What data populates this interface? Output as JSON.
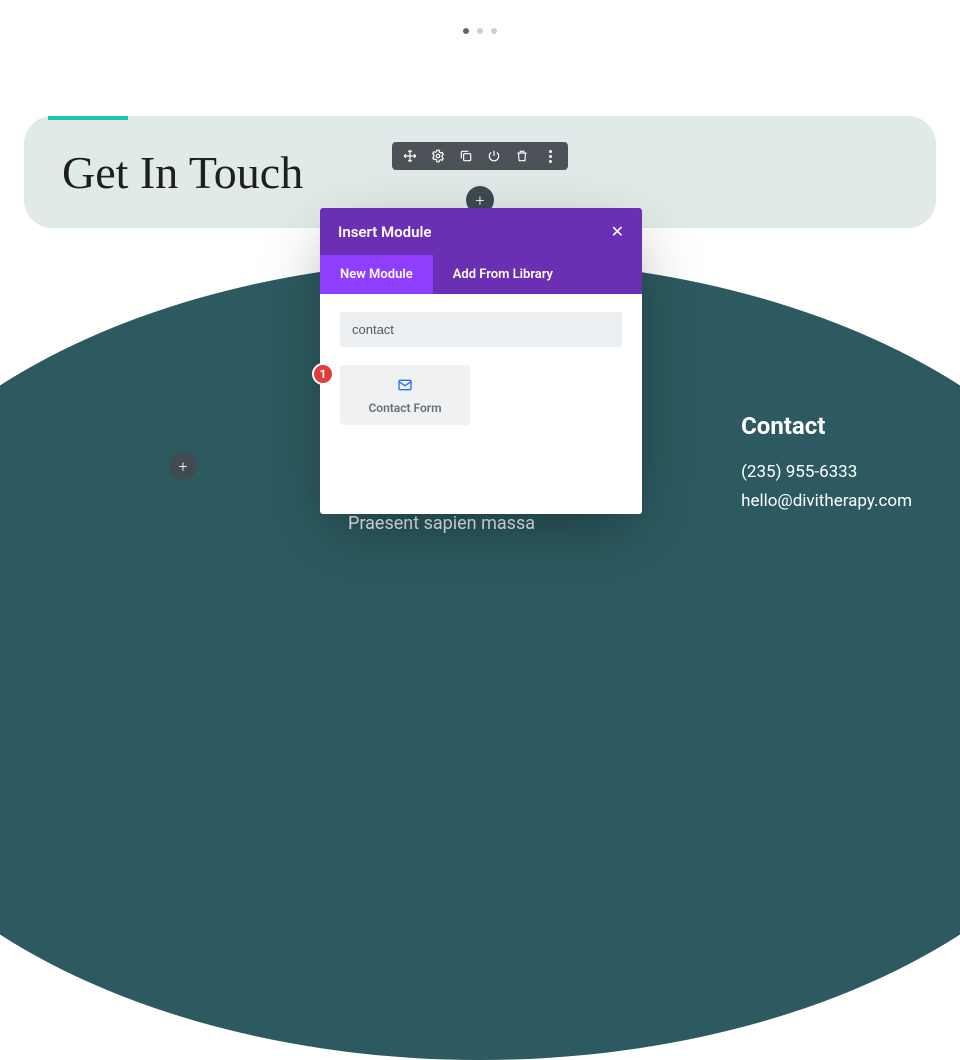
{
  "hero": {
    "title": "Get In Touch"
  },
  "toolbar": {
    "icons": [
      "move-icon",
      "gear-icon",
      "duplicate-icon",
      "power-icon",
      "trash-icon",
      "more-icon"
    ]
  },
  "add_buttons": {
    "center": "+",
    "left": "+"
  },
  "modal": {
    "title": "Insert Module",
    "close_label": "✕",
    "tabs": {
      "new": "New Module",
      "library": "Add From Library"
    },
    "search_value": "contact",
    "modules": [
      {
        "id": "contact-form",
        "label": "Contact Form"
      }
    ]
  },
  "step_badge": "1",
  "footer": {
    "heading": "Contact",
    "phone": "(235) 955-6333",
    "email": "hello@divitherapy.com",
    "lorem": "Praesent sapien massa"
  },
  "pager": {
    "count": 3,
    "active": 0
  }
}
